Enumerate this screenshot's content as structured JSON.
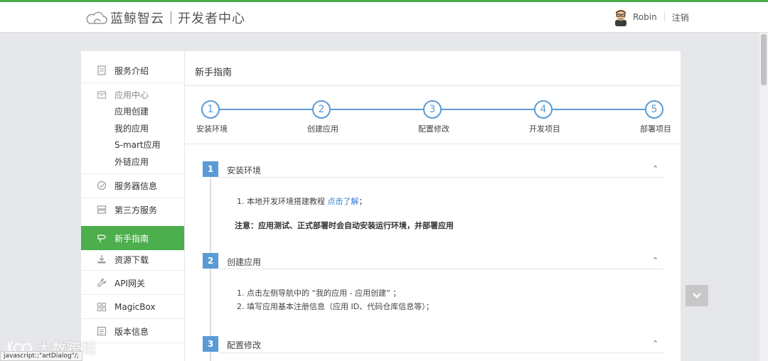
{
  "header": {
    "brand": "蓝鲸智云",
    "subtitle": "开发者中心",
    "user_name": "Robin",
    "logout_label": "注销"
  },
  "sidebar": {
    "items": [
      {
        "label": "服务介绍",
        "icon": "document-icon"
      },
      {
        "label": "应用中心",
        "icon": "box-icon"
      },
      {
        "label": "服务器信息",
        "icon": "check-circle-icon"
      },
      {
        "label": "第三方服务",
        "icon": "server-icon"
      },
      {
        "label": "新手指南",
        "icon": "signpost-icon"
      },
      {
        "label": "资源下载",
        "icon": "download-icon"
      },
      {
        "label": "API网关",
        "icon": "wrench-icon"
      },
      {
        "label": "MagicBox",
        "icon": "grid-icon"
      },
      {
        "label": "版本信息",
        "icon": "version-icon"
      }
    ],
    "app_center_sub": [
      "应用创建",
      "我的应用",
      "S-mart应用",
      "外链应用"
    ],
    "active_color": "#4cae4c"
  },
  "main": {
    "title": "新手指南",
    "steps": [
      {
        "num": "1",
        "label": "安装环境"
      },
      {
        "num": "2",
        "label": "创建应用"
      },
      {
        "num": "3",
        "label": "配置修改"
      },
      {
        "num": "4",
        "label": "开发项目"
      },
      {
        "num": "5",
        "label": "部署项目"
      }
    ],
    "sections": [
      {
        "num": "1",
        "title": "安装环境",
        "line1_prefix": "1. 本地开发环境搭建教程 ",
        "line1_link": "点击了解",
        "line1_suffix": "；",
        "note": "注意：应用测试、正式部署时会自动安装运行环境，并部署应用"
      },
      {
        "num": "2",
        "title": "创建应用",
        "lines": [
          "1. 点击左侧导航中的 “我的应用 - 应用创建” ；",
          "2. 填写应用基本注册信息（应用 ID、代码仓库信息等）；"
        ]
      },
      {
        "num": "3",
        "title": "配置修改"
      }
    ],
    "accent_color": "#5b9bd5"
  },
  "watermark": "大数跨境",
  "status_text": "javascript:;\"artDialog\"/;"
}
